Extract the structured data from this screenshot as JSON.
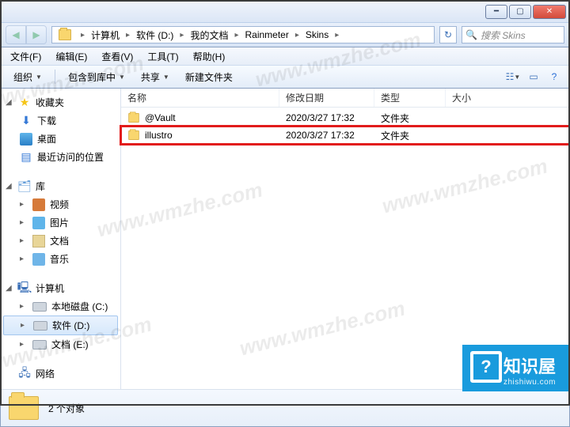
{
  "breadcrumb": [
    "计算机",
    "软件 (D:)",
    "我的文档",
    "Rainmeter",
    "Skins"
  ],
  "search_placeholder": "搜索 Skins",
  "menu": {
    "file": "文件(F)",
    "edit": "编辑(E)",
    "view": "查看(V)",
    "tools": "工具(T)",
    "help": "帮助(H)"
  },
  "toolbar": {
    "organize": "组织",
    "include": "包含到库中",
    "share": "共享",
    "new_folder": "新建文件夹"
  },
  "columns": {
    "name": "名称",
    "date": "修改日期",
    "type": "类型",
    "size": "大小"
  },
  "rows": [
    {
      "name": "@Vault",
      "date": "2020/3/27 17:32",
      "type": "文件夹",
      "size": ""
    },
    {
      "name": "illustro",
      "date": "2020/3/27 17:32",
      "type": "文件夹",
      "size": ""
    }
  ],
  "tree": {
    "favorites": {
      "label": "收藏夹",
      "items": [
        "下载",
        "桌面",
        "最近访问的位置"
      ]
    },
    "libraries": {
      "label": "库",
      "items": [
        "视频",
        "图片",
        "文档",
        "音乐"
      ]
    },
    "computer": {
      "label": "计算机",
      "items": [
        "本地磁盘 (C:)",
        "软件 (D:)",
        "文档 (E:)"
      ]
    },
    "network": {
      "label": "网络"
    }
  },
  "status": {
    "count": "2 个对象"
  },
  "watermark": "www.wmzhe.com",
  "badge": {
    "title": "知识屋",
    "sub": "zhishiwu.com"
  }
}
